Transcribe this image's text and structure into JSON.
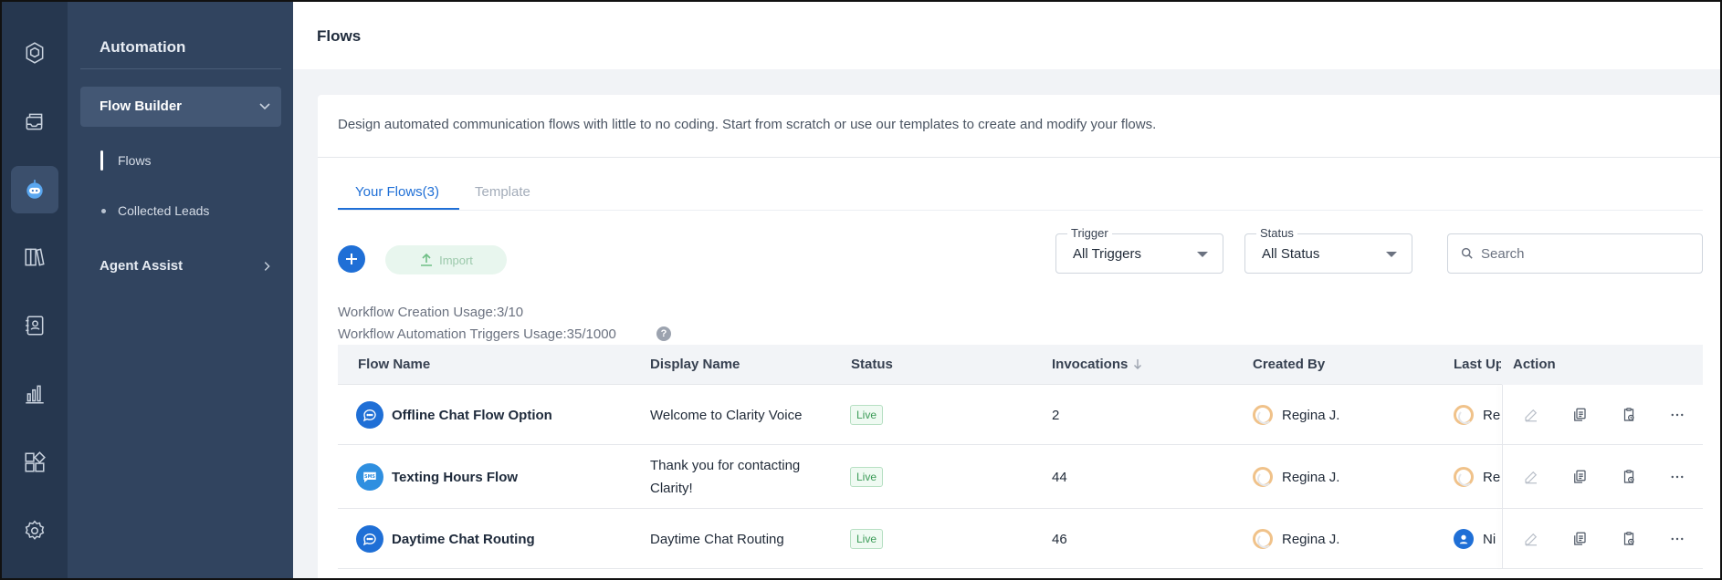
{
  "rail": {
    "items": [
      {
        "icon": "cube-icon",
        "active": false
      },
      {
        "icon": "inbox-icon",
        "active": false
      },
      {
        "icon": "bot-icon",
        "active": true
      },
      {
        "icon": "books-icon",
        "active": false
      },
      {
        "icon": "contacts-icon",
        "active": false
      },
      {
        "icon": "bar-chart-icon",
        "active": false
      },
      {
        "icon": "apps-icon",
        "active": false
      },
      {
        "icon": "gear-icon",
        "active": false
      }
    ]
  },
  "side": {
    "title": "Automation",
    "group": "Flow Builder",
    "sub_items": [
      "Flows",
      "Collected Leads"
    ],
    "agent_assist": "Agent Assist"
  },
  "page": {
    "title": "Flows",
    "description": "Design automated communication flows with little to no coding. Start from scratch or use our templates to create and modify your flows."
  },
  "tabs": {
    "active": "Your Flows(3)",
    "inactive": "Template"
  },
  "toolbar": {
    "import_label": "Import",
    "trigger_label": "Trigger",
    "trigger_value": "All Triggers",
    "status_label": "Status",
    "status_value": "All Status",
    "search_placeholder": "Search"
  },
  "usage": {
    "creation": "Workflow Creation Usage:3/10",
    "triggers": "Workflow Automation Triggers Usage:35/1000",
    "help": "?"
  },
  "table": {
    "headers": {
      "flow_name": "Flow Name",
      "display_name": "Display Name",
      "status": "Status",
      "invocations": "Invocations",
      "created_by": "Created By",
      "last_updated": "Last Up",
      "action": "Action"
    },
    "rows": [
      {
        "icon": "chat-bubble-icon",
        "flow_name": "Offline Chat Flow Option",
        "display_name": "Welcome to Clarity Voice",
        "display_name_2": "",
        "status": "Live",
        "invocations": "2",
        "created_by": "Regina J.",
        "last_updated": "Re"
      },
      {
        "icon": "sms-icon",
        "flow_name": "Texting Hours Flow",
        "display_name": "Thank you for contacting",
        "display_name_2": "Clarity!",
        "status": "Live",
        "invocations": "44",
        "created_by": "Regina J.",
        "last_updated": "Re"
      },
      {
        "icon": "chat-bubble-icon",
        "flow_name": "Daytime Chat Routing",
        "display_name": "Daytime Chat Routing",
        "display_name_2": "",
        "status": "Live",
        "invocations": "46",
        "created_by": "Regina J.",
        "last_updated": "Ni"
      }
    ]
  },
  "colors": {
    "rail_bg": "#26374f",
    "side_bg": "#31445f",
    "accent": "#1f6fd6",
    "live_green": "#3b9b57"
  }
}
